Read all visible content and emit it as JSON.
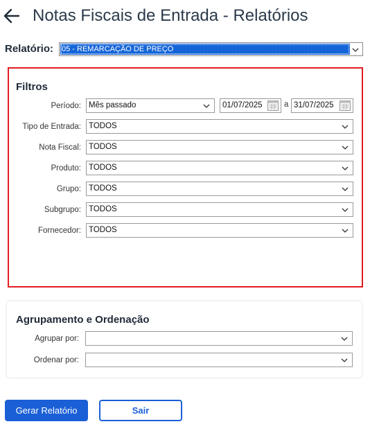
{
  "header": {
    "title": "Notas Fiscais de Entrada - Relatórios",
    "back_icon": "arrow-left-icon"
  },
  "report": {
    "label": "Relatório:",
    "selected": "05 - REMARCAÇÃO DE PREÇO"
  },
  "filters": {
    "title": "Filtros",
    "periodo": {
      "label": "Período:",
      "value": "Mês passado",
      "start_date": "01/07/2025",
      "separator": "a",
      "end_date": "31/07/2025"
    },
    "tipo_entrada": {
      "label": "Tipo de Entrada:",
      "value": "TODOS"
    },
    "nota_fiscal": {
      "label": "Nota Fiscal:",
      "value": "TODOS"
    },
    "produto": {
      "label": "Produto:",
      "value": "TODOS"
    },
    "grupo": {
      "label": "Grupo:",
      "value": "TODOS"
    },
    "subgrupo": {
      "label": "Subgrupo:",
      "value": "TODOS"
    },
    "fornecedor": {
      "label": "Fornecedor:",
      "value": "TODOS"
    }
  },
  "grouping": {
    "title": "Agrupamento e Ordenação",
    "agrupar": {
      "label": "Agrupar por:",
      "value": ""
    },
    "ordenar": {
      "label": "Ordenar por:",
      "value": ""
    }
  },
  "actions": {
    "generate_label": "Gerar Relatório",
    "exit_label": "Sair"
  },
  "colors": {
    "accent": "#1a5fd6",
    "highlight": "#1565d8",
    "filters_border": "#e11b22"
  }
}
